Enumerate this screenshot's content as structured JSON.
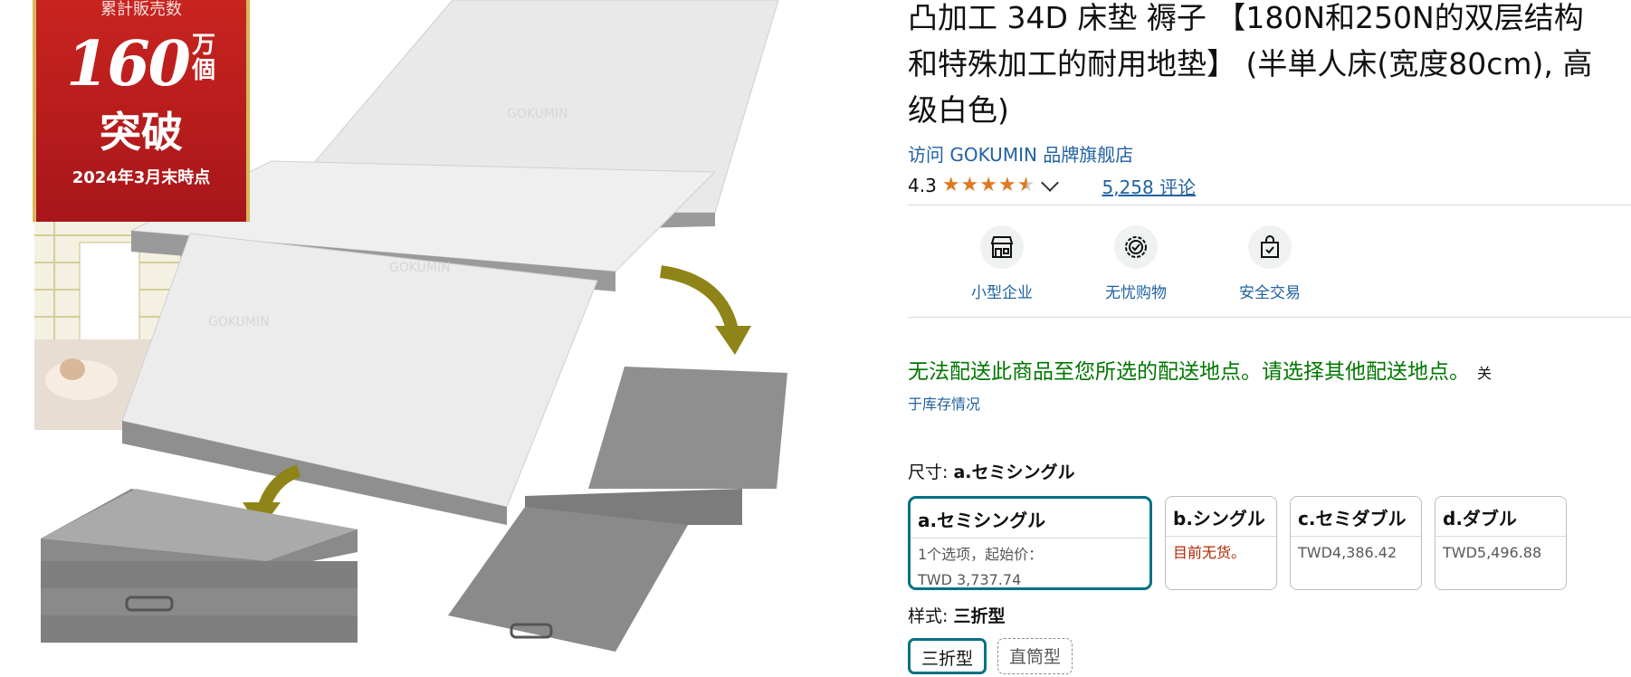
{
  "image": {
    "badge_top": "累計販売数",
    "badge_count": "160",
    "badge_unit": "万個",
    "badge_break": "突破",
    "badge_date": "2024年3月末時点",
    "brand_mark": "GOKUMIN"
  },
  "product": {
    "title": "凸加工 34D 床垫 褥子 【180N和250N的双层结构和特殊加工的耐用地垫】 (半単人床(宽度80cm), 高级白色)",
    "store_link": "访问 GOKUMIN 品牌旗舰店",
    "rating": "4.3",
    "rating_value": 4.3,
    "reviews": "5,258 评论"
  },
  "features": [
    {
      "icon": "storefront-icon",
      "label": "小型企业"
    },
    {
      "icon": "badge-check-icon",
      "label": "无忧购物"
    },
    {
      "icon": "secure-bag-icon",
      "label": "安全交易"
    }
  ],
  "delivery": {
    "message": "无法配送此商品至您所选的配送地点。请选择其他配送地点。",
    "close_text": "关",
    "stock_link": "于库存情况"
  },
  "size": {
    "label": "尺寸:",
    "selected": "a.セミシングル",
    "options": [
      {
        "name": "a.セミシングル",
        "line1": "1个选项，起始价：",
        "line2": "TWD 3,737.74"
      },
      {
        "name": "b.シングル",
        "line1": "目前无货。"
      },
      {
        "name": "c.セミダブル",
        "line1": "TWD4,386.42"
      },
      {
        "name": "d.ダブル",
        "line1": "TWD5,496.88"
      }
    ]
  },
  "style": {
    "label": "样式:",
    "selected": "三折型",
    "options": [
      "三折型",
      "直筒型"
    ]
  },
  "colors": {
    "link": "#2162A1",
    "star": "#DE7921",
    "selected_border": "#007185",
    "delivery_green": "#007600",
    "out_of_stock": "#B12704",
    "badge_red": "#c8241f"
  }
}
